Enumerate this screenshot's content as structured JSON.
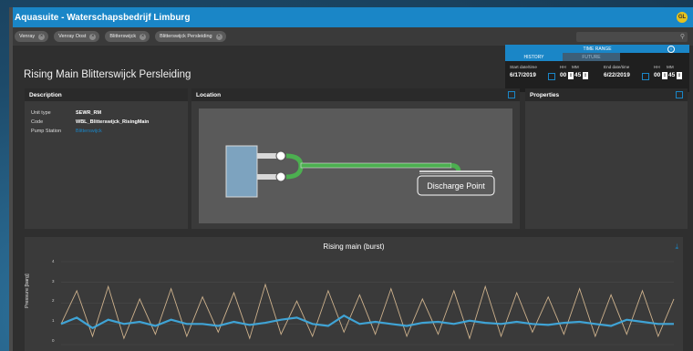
{
  "app": {
    "title": "Aquasuite - Waterschapsbedrijf Limburg",
    "avatar": "GL"
  },
  "filters": [
    {
      "label": "Venray"
    },
    {
      "label": "Venray Oost"
    },
    {
      "label": "Blitterswijck"
    },
    {
      "label": "Blitterswijck Persleiding"
    }
  ],
  "page": {
    "title": "Rising Main Blitterswijck Persleiding"
  },
  "time_range": {
    "header": "TIME RANGE",
    "tabs": [
      "HISTORY",
      "FUTURE"
    ],
    "start_label": "Start date/time",
    "end_label": "End date/time",
    "hh_label": "HH",
    "mm_label": "MM",
    "start_date": "6/17/2019",
    "start_hh": "00",
    "start_mm": "45",
    "end_date": "6/22/2019",
    "end_hh": "00",
    "end_mm": "45"
  },
  "description": {
    "title": "Description",
    "rows": [
      {
        "key": "Unit type",
        "value": "SEWR_RM"
      },
      {
        "key": "Code",
        "value": "WBL_Blitterswijck_RisingMain"
      },
      {
        "key": "Pump Station",
        "value": "Blitterswijck"
      }
    ]
  },
  "location": {
    "title": "Location",
    "discharge_label": "Discharge Point"
  },
  "properties": {
    "title": "Properties"
  },
  "chart": {
    "title": "Rising main (burst)",
    "ylabel": "Pressure [barg]",
    "yticks": [
      "4",
      "3",
      "2",
      "1",
      "0"
    ]
  },
  "colors": {
    "accent": "#1a86c7",
    "series_blue": "#3fa9dd",
    "series_tan": "#e7c79b",
    "pipe_green": "#4caf50"
  },
  "chart_data": {
    "type": "line",
    "title": "Rising main (burst)",
    "ylabel": "Pressure [barg]",
    "ylim": [
      0,
      4
    ],
    "series": [
      {
        "values": [
          1.0,
          1.3,
          0.8,
          1.2,
          1.0,
          1.1,
          0.9,
          1.2,
          1.0,
          1.0,
          0.9,
          1.1,
          0.95,
          1.05,
          1.2,
          1.3,
          1.0,
          0.9,
          1.4,
          1.0,
          1.1,
          1.0,
          0.9,
          1.05,
          1.1,
          1.0,
          1.15,
          1.05,
          1.0,
          1.1,
          1.0,
          0.95,
          1.05,
          1.1,
          1.0,
          0.9,
          1.2,
          1.1,
          1.0,
          1.0
        ]
      },
      {
        "values": [
          1.0,
          2.6,
          0.4,
          2.8,
          0.3,
          2.2,
          0.5,
          2.7,
          0.4,
          2.3,
          0.6,
          2.5,
          0.3,
          2.9,
          0.5,
          2.1,
          0.4,
          2.6,
          0.6,
          2.4,
          0.5,
          2.7,
          0.4,
          2.2,
          0.5,
          2.6,
          0.3,
          2.8,
          0.4,
          2.5,
          0.6,
          2.3,
          0.5,
          2.7,
          0.4,
          2.4,
          0.5,
          2.6,
          0.4,
          2.2
        ]
      }
    ]
  }
}
